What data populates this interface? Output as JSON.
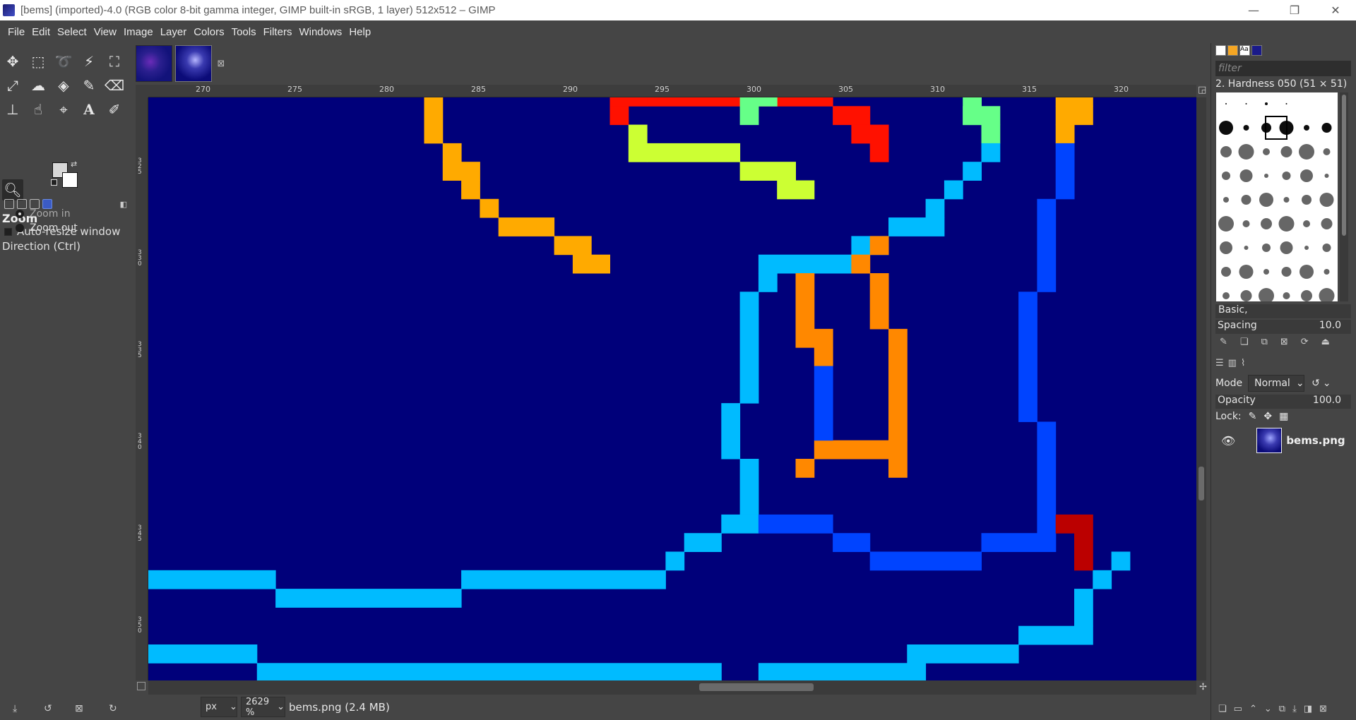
{
  "window": {
    "title": "[bems] (imported)-4.0 (RGB color 8-bit gamma integer, GIMP built-in sRGB, 1 layer) 512x512 – GIMP",
    "minimize": "—",
    "maximize": "❐",
    "close": "✕"
  },
  "menubar": [
    "File",
    "Edit",
    "Select",
    "View",
    "Image",
    "Layer",
    "Colors",
    "Tools",
    "Filters",
    "Windows",
    "Help"
  ],
  "toolbox": {
    "tools": [
      "move-tool",
      "rect-select-tool",
      "free-select-tool",
      "fuzzy-select-tool",
      "crop-tool",
      "unified-transform-tool",
      "warp-tool",
      "bucket-fill-tool",
      "paintbrush-tool",
      "eraser-tool",
      "clone-tool",
      "smudge-tool",
      "paths-tool",
      "text-tool",
      "color-picker-tool",
      "zoom-tool"
    ],
    "fg_color": "#d8d8d8",
    "bg_color": "#ffffff"
  },
  "tool_options": {
    "title": "Zoom",
    "auto_resize": "Auto-resize window",
    "direction_label": "Direction  (Ctrl)",
    "zoom_in": "Zoom in",
    "zoom_out": "Zoom out",
    "selected_direction": "Zoom in"
  },
  "rulers": {
    "horizontal": [
      "270",
      "275",
      "280",
      "285",
      "290",
      "295",
      "300",
      "305",
      "310",
      "315",
      "320"
    ],
    "vertical": [
      "325",
      "330",
      "335",
      "340",
      "345",
      "350"
    ]
  },
  "statusbar": {
    "unit": "px",
    "zoom": "2629 %",
    "file": "bems.png (2.4 MB)"
  },
  "brushes": {
    "filter_placeholder": "filter",
    "selected_brush": "2. Hardness 050 (51 × 51)",
    "tag": "Basic,",
    "spacing_label": "Spacing",
    "spacing_value": "10.0"
  },
  "layers": {
    "mode_label": "Mode",
    "mode_value": "Normal",
    "opacity_label": "Opacity",
    "opacity_value": "100.0",
    "lock_label": "Lock:",
    "layer_name": "bems.png"
  },
  "colors": {
    "canvas_bg": "#00007a",
    "orange": "#ffaa00",
    "dark_orange": "#ff8800",
    "red": "#ff1100",
    "dark_red": "#bb0000",
    "lime": "#ccff33",
    "mint": "#66ff88",
    "cyan": "#00bbff",
    "blue": "#0044ff"
  }
}
